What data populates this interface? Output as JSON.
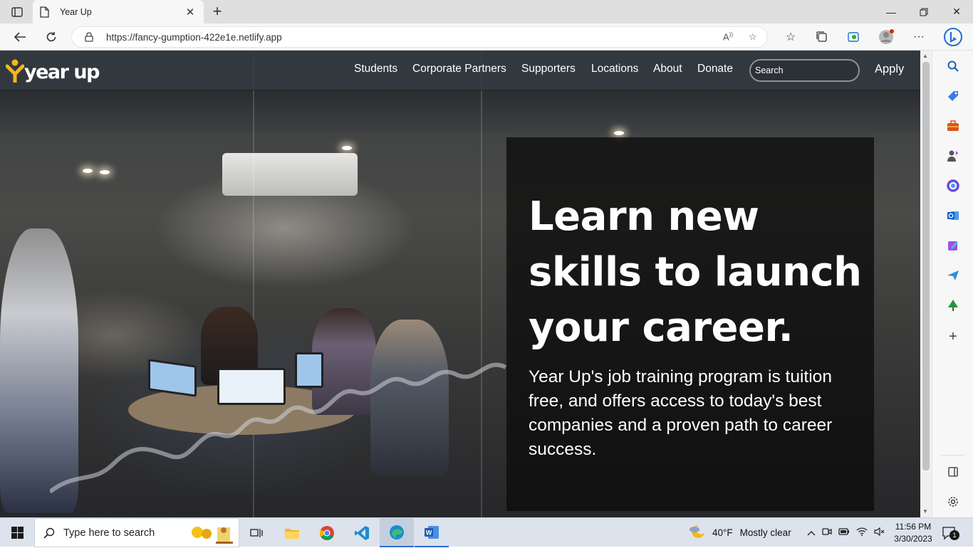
{
  "browser": {
    "tab_title": "Year Up",
    "url": "https://fancy-gumption-422e1e.netlify.app"
  },
  "site": {
    "logo_text": "year up",
    "nav": [
      "Students",
      "Corporate Partners",
      "Supporters",
      "Locations",
      "About",
      "Donate"
    ],
    "search_placeholder": "Search",
    "apply": "Apply"
  },
  "hero": {
    "headline_lines": [
      "Learn new",
      "skills to launch",
      "your career."
    ],
    "body": "Year Up's job training program is tuition free, and offers access to today's best companies and a proven path to career success."
  },
  "taskbar": {
    "search_placeholder": "Type here to search",
    "weather_temp": "40°F",
    "weather_desc": "Mostly clear",
    "time": "11:56 PM",
    "date": "3/30/2023",
    "notification_count": "1"
  },
  "colors": {
    "logo_accent": "#f4b81c",
    "nav_bg": "#30373e",
    "hero_panel": "#0c0c0c"
  }
}
